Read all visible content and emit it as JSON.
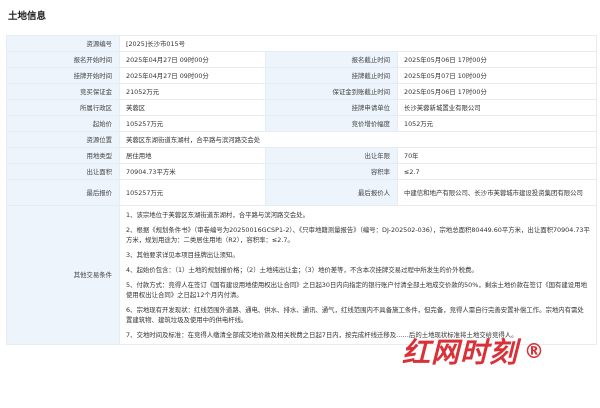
{
  "title": "土地信息",
  "rows": [
    {
      "type": "wide",
      "label": "资源编号",
      "value": "[2025]长沙市015号"
    },
    {
      "type": "pair",
      "label1": "报名开始时间",
      "value1": "2025年04月27日 09时00分",
      "label2": "报名截止时间",
      "value2": "2025年05月06日 17时00分"
    },
    {
      "type": "pair",
      "label1": "挂牌开始时间",
      "value1": "2025年04月27日 09时00分",
      "label2": "挂牌截止时间",
      "value2": "2025年05月07日 10时00分"
    },
    {
      "type": "pair",
      "label1": "竞买保证金",
      "value1": "21052万元",
      "label2": "保证金到账截止时间",
      "value2": "2025年05月06日 17时00分"
    },
    {
      "type": "pair",
      "label1": "所属行政区",
      "value1": "芙蓉区",
      "label2": "挂牌申请单位",
      "value2": "长沙芙蓉新城置业有限公司"
    },
    {
      "type": "pair",
      "label1": "起始价",
      "value1": "105257万元",
      "label2": "竞价增价幅度",
      "value2": "1052万元"
    },
    {
      "type": "wide",
      "label": "资源位置",
      "value": "芙蓉区东湖街道东湖村，合平路与滨河路交会处"
    },
    {
      "type": "pair",
      "label1": "用地类型",
      "value1": "居住用地",
      "label2": "出让年限",
      "value2": "70年"
    },
    {
      "type": "pair",
      "label1": "出让面积",
      "value1": "70904.73平方米",
      "label2": "容积率",
      "value2": "≤2.7"
    },
    {
      "type": "pair",
      "label1": "最后报价",
      "value1": "105257万元",
      "label2": "最后报价人",
      "value2": "中建信和地产有限公司、长沙市芙蓉城市建设投资集团有限公司"
    }
  ],
  "other_terms": {
    "label": "其他交易条件",
    "clauses": [
      "1、该宗地位于芙蓉区东湖街道东湖村，合平路与滨河路交会处。",
      "2、根据《规划条件书》（审卷编号为20250016GCSP1-2）、《只审地籍测量报告》（编号：DJ-202502-036），宗地总面积80449.60平方米，出让面积70904.73平方米，规划用途为：二类居住用地（R2），容积率：≤2.7。",
      "3、其他要求详见本项目挂牌出让须知。",
      "4、起始价包含：（1）土地的规划报价格；（2）土地纯出让金；（3）地价差等，不含本次挂牌交易过程中所发生的价外税费。",
      "5、付款方式：竞得人在签订《国有建设用地使用权出让合同》之日起30日内向指定的银行账户付清全部土地成交价款的50%，剩余土地价款在签订《国有建设用地使用权出让合同》之日起12个月内付清。",
      "6、宗地现有开发现状：红线范围外道路、通电、供水、排水、通讯、通气，红线范围内不具备施工条件，但完备，竞得人需自行完善安置补偿工作。宗地内有需处置建筑物、建筑垃圾及使用中的供电杆线。",
      "7、交地时间及标准：在竞得人缴清全部成交地价款及相关税费之日起7日内，按完成杆线迁移及……后的土地现状标准将土地交给竞得人。"
    ]
  },
  "watermark": {
    "text": "红网时刻",
    "mark": "®"
  }
}
